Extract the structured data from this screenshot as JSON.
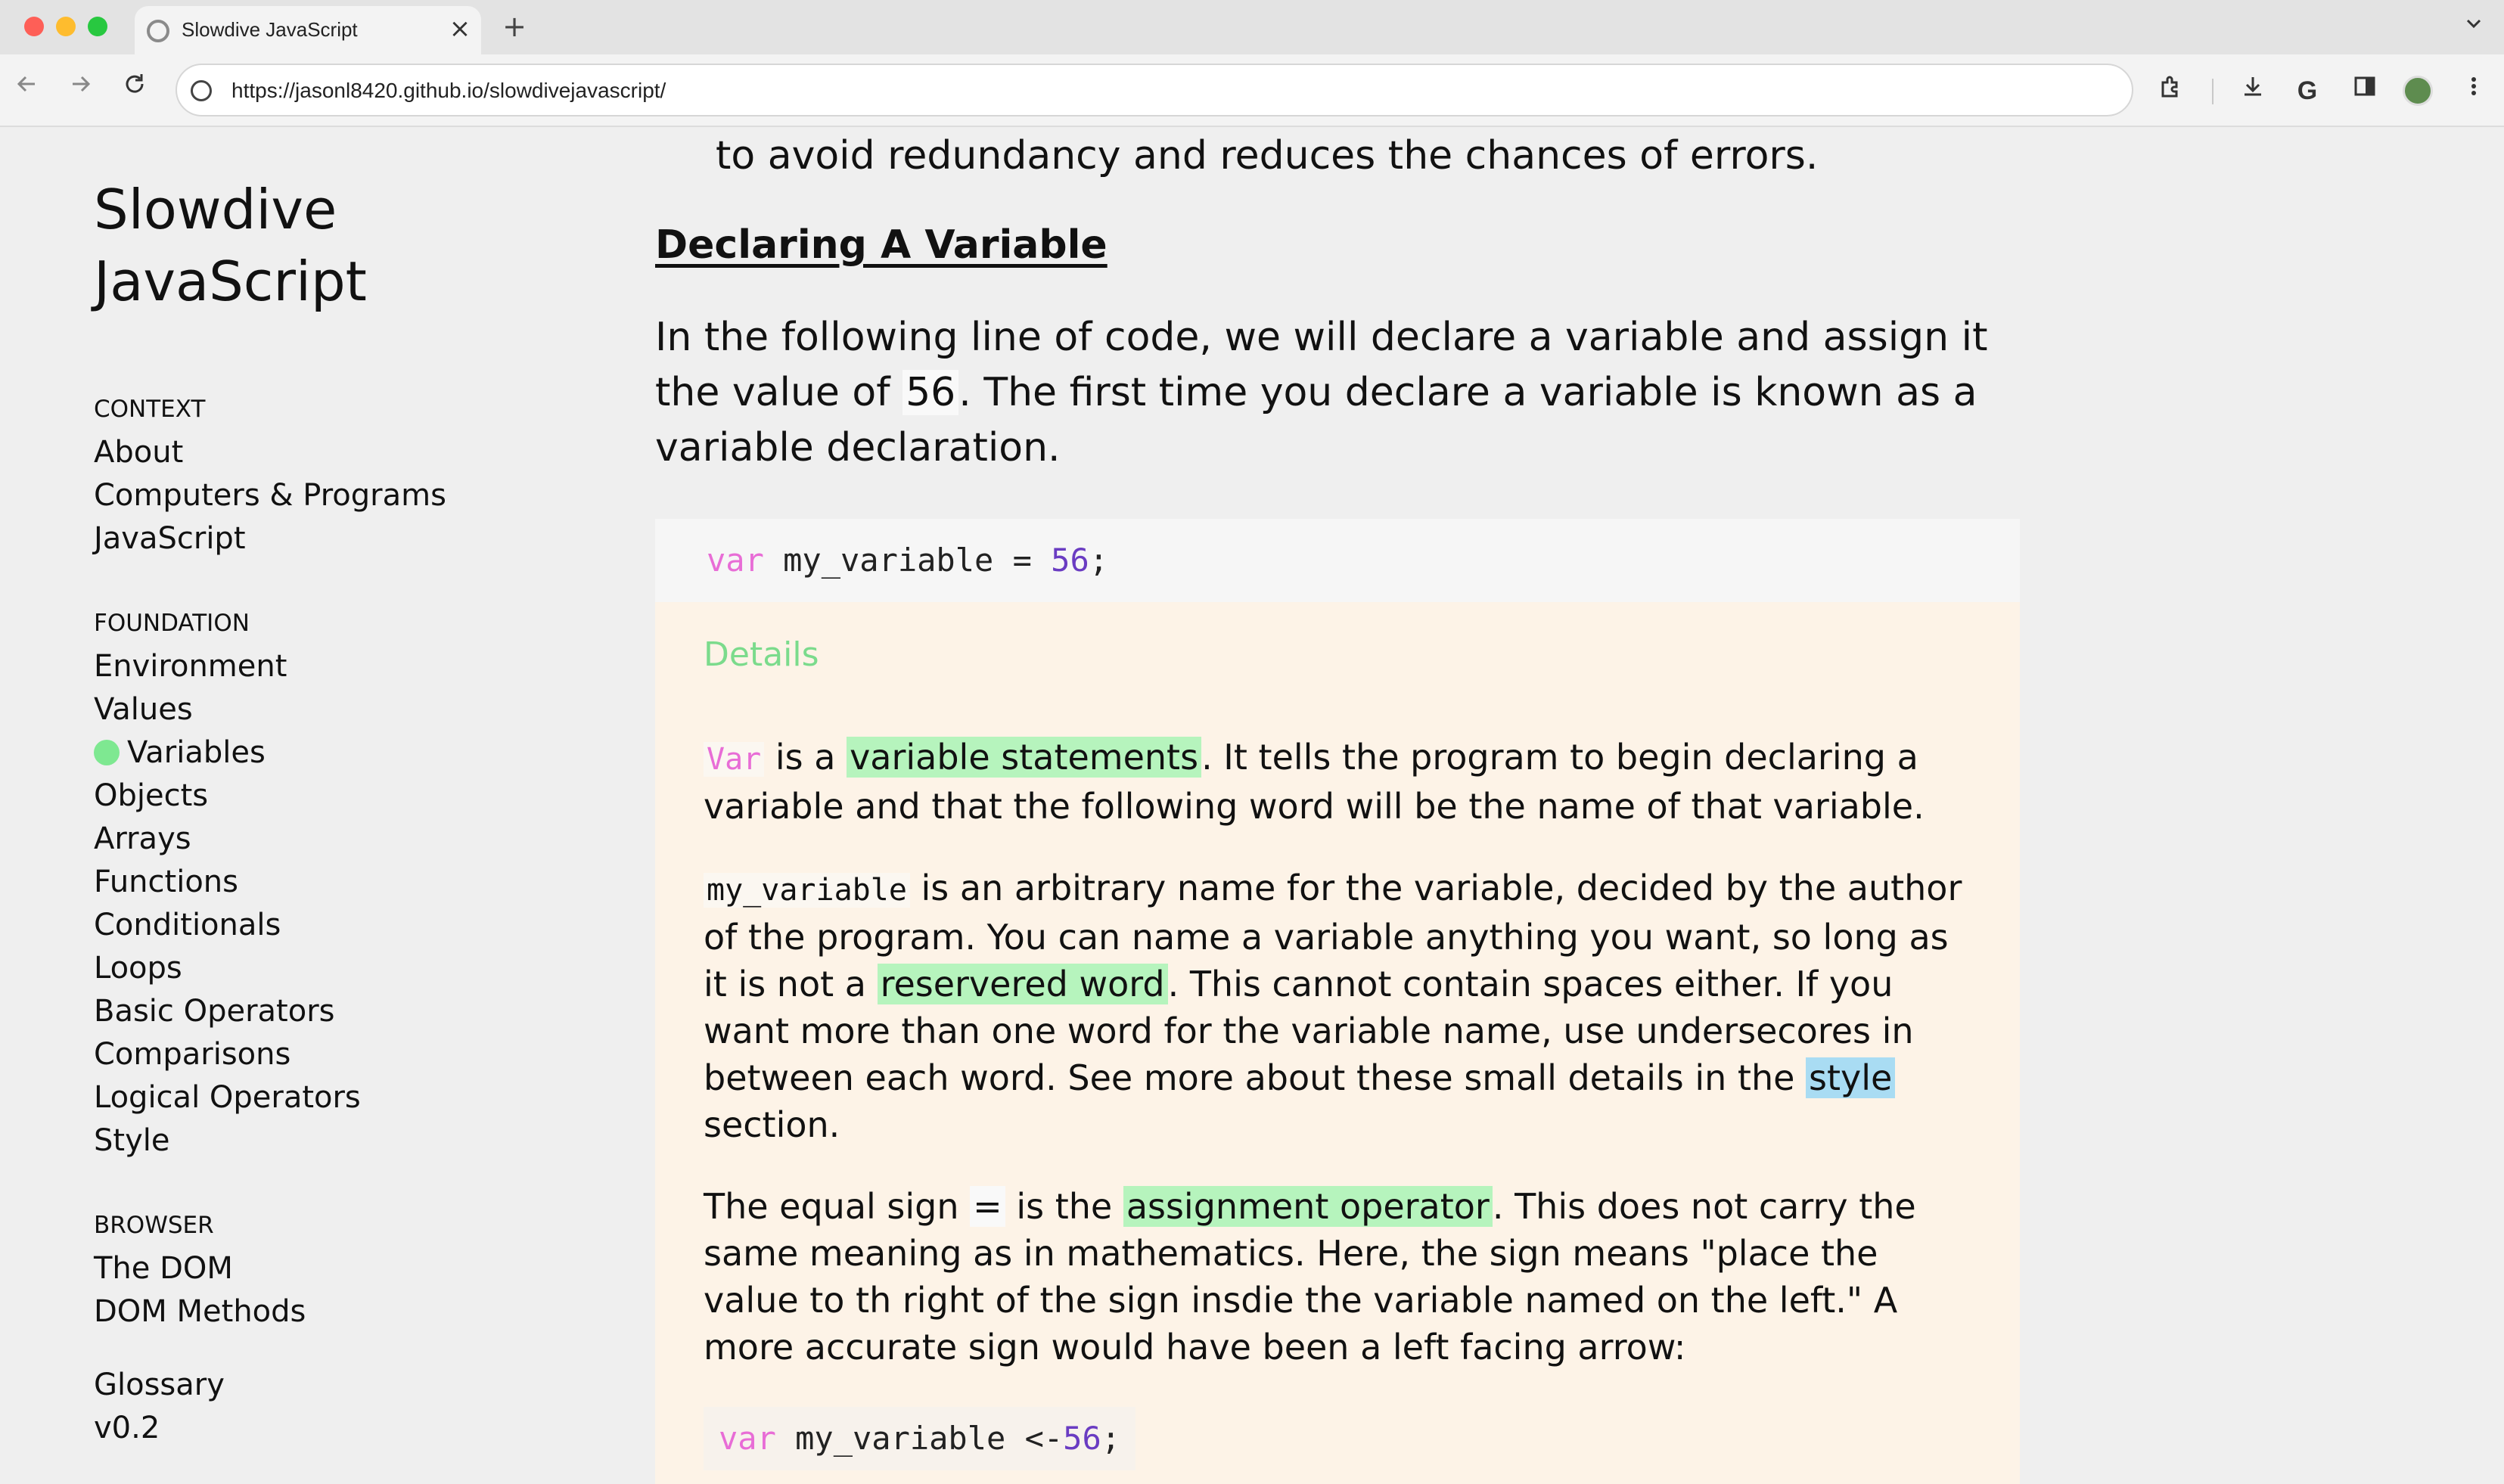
{
  "browser": {
    "tab_title": "Slowdive JavaScript",
    "tab_close": "×",
    "new_tab": "+",
    "tab_dropdown": "⌄",
    "url": "https://jasonl8420.github.io/slowdivejavascript/",
    "icons": [
      "back-icon",
      "forward-icon",
      "reload-icon",
      "extensions-icon",
      "download-icon",
      "google-icon",
      "sidepanel-icon",
      "profile-icon",
      "menu-icon"
    ]
  },
  "sidebar": {
    "title_line1": "Slowdive",
    "title_line2": "JavaScript",
    "sections": [
      {
        "heading": "CONTEXT",
        "items": [
          "About",
          "Computers & Programs",
          "JavaScript"
        ]
      },
      {
        "heading": "FOUNDATION",
        "items": [
          "Environment",
          "Values",
          "Variables",
          "Objects",
          "Arrays",
          "Functions",
          "Conditionals",
          "Loops",
          "Basic Operators",
          "Comparisons",
          "Logical Operators",
          "Style"
        ]
      },
      {
        "heading": "BROWSER",
        "items": [
          "The DOM",
          "DOM Methods"
        ]
      }
    ],
    "active_item": "Variables",
    "footer": {
      "glossary": "Glossary",
      "version": "v0.2"
    }
  },
  "content": {
    "lead_line": "to avoid redundancy and reduces the chances of errors.",
    "heading": "Declaring A Variable",
    "intro_pre": "In the following line of code, we will declare a variable and assign it the value of ",
    "intro_value": "56",
    "intro_post": ". The first time you declare a variable is known as a variable declaration.",
    "code": {
      "keyword": "var",
      "name": " my_variable = ",
      "number": "56",
      "end": ";"
    },
    "details": {
      "title": "Details",
      "p1": {
        "code": "Var",
        "mid": " is a ",
        "term": "variable statements",
        "rest": ". It tells the program to begin declaring a variable and that the following word will be the name of that variable."
      },
      "p2": {
        "code": "my_variable",
        "mid": " is an arbitrary name for the variable, decided by the author of the program. You can name a variable anything you want, so long as it is not a ",
        "term": "reservered word",
        "rest": ". This cannot contain spaces either. If you want more than one word for the variable name, use undersecores in between each word. See more about these small details in the ",
        "link": "style",
        "end": " section."
      },
      "p3": {
        "pre": "The equal sign ",
        "sign": "=",
        "mid": " is the ",
        "term": "assignment operator",
        "rest": ". This does not carry the same meaning as in mathematics. Here, the sign means \"place the value to th right of the sign insdie the variable named on the left.\" A more accurate sign would have been a left facing arrow:"
      },
      "code2": {
        "keyword": "var",
        "name": " my_variable <-",
        "number": "56",
        "end": ";"
      }
    }
  },
  "colors": {
    "accent_green": "#7ee891",
    "keyword_pink": "#e86dd6",
    "number_purple": "#6a3cc2",
    "details_bg": "#fdf3e7"
  }
}
